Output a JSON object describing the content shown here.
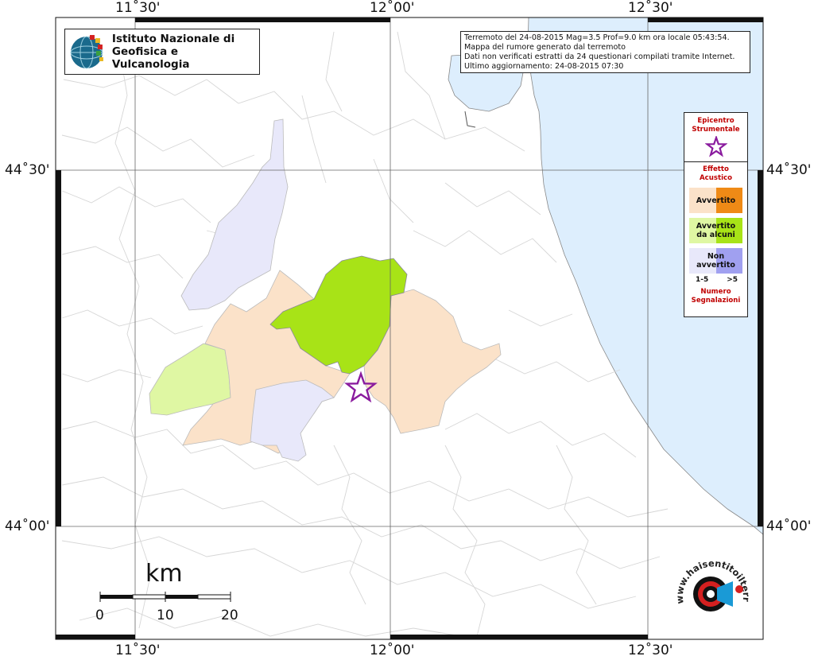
{
  "logo": {
    "line1": "Istituto Nazionale di",
    "line2": "Geofisica e Vulcanologia"
  },
  "info": {
    "line1": "Terremoto del 24-08-2015 Mag=3.5 Prof=9.0 km ora locale 05:43:54.",
    "line2": "Mappa del rumore generato dal terremoto",
    "line3": "Dati non verificati estratti da 24 questionari compilati tramite Internet.",
    "line4": "Ultimo aggiornamento: 24-08-2015 07:30"
  },
  "axes": {
    "lon_ticks": [
      "11˚30'",
      "12˚00'",
      "12˚30'"
    ],
    "lat_ticks": [
      "44˚30'",
      "44˚00'"
    ]
  },
  "legend": {
    "epicenter_title": "Epicentro\nStrumentale",
    "effect_title": "Effetto\nAcustico",
    "items": [
      {
        "label": "Avvertito",
        "color_low": "#fbe2c9",
        "color_high": "#ef8a16"
      },
      {
        "label": "Avvertito\nda alcuni",
        "color_low": "#dff7a3",
        "color_high": "#a8e317"
      },
      {
        "label": "Non\navvertito",
        "color_low": "#e8e8fa",
        "color_high": "#a0a0f0"
      }
    ],
    "count_low": "1-5",
    "count_high": ">5",
    "count_title": "Numero\nSegnalazioni"
  },
  "colors": {
    "sea": "#ddeefd",
    "felt_few": "#a8e317",
    "felt_low": "#fbe2c9",
    "felt_few_low": "#dff7a3",
    "not_felt_low": "#e8e8fa",
    "epicenter": "#8a1b9e"
  },
  "scale": {
    "unit": "km",
    "labels": [
      "0",
      "10",
      "20"
    ]
  },
  "watermark": {
    "text": "www.haisentitoilterremoto.it"
  }
}
